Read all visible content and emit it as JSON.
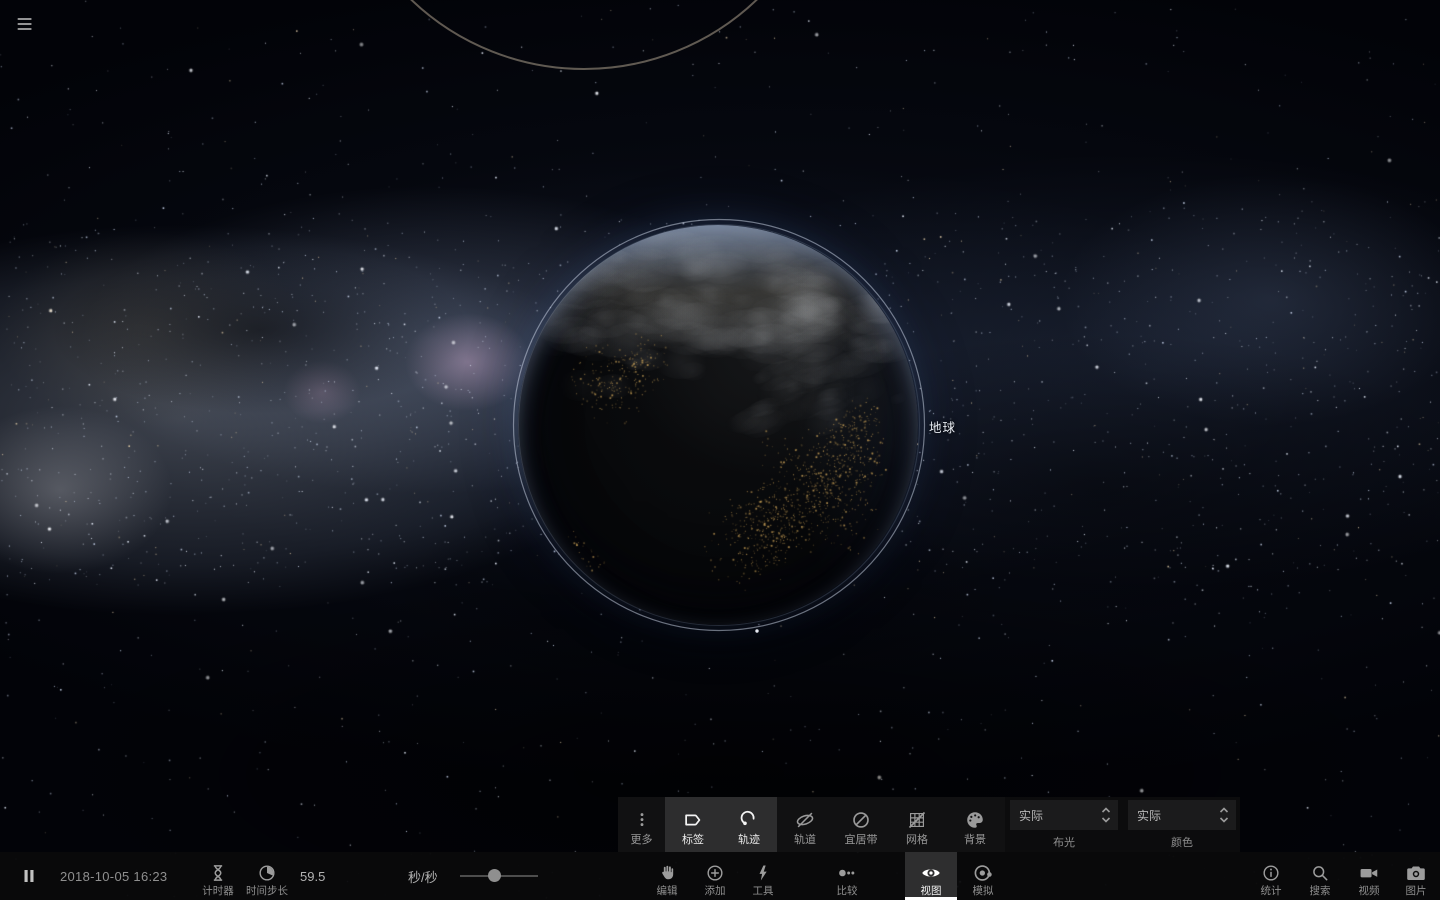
{
  "scene": {
    "body_label": "地球"
  },
  "view_panel": {
    "more_label": "更多",
    "toggles": [
      {
        "id": "labels",
        "label": "标签",
        "active": true
      },
      {
        "id": "trails",
        "label": "轨迹",
        "active": true
      },
      {
        "id": "orbits",
        "label": "轨道",
        "active": false
      },
      {
        "id": "habitable",
        "label": "宜居带",
        "active": false
      },
      {
        "id": "grid",
        "label": "网格",
        "active": false
      },
      {
        "id": "background",
        "label": "背景",
        "active": false
      }
    ],
    "lighting": {
      "value": "实际",
      "label": "布光"
    },
    "color": {
      "value": "实际",
      "label": "颜色"
    }
  },
  "time_bar": {
    "datetime": "2018-10-05 16:23",
    "timer_label": "计时器",
    "timestep_label": "时间步长",
    "timestep_value": "59.5",
    "timestep_unit": "秒/秒",
    "slider_percent": 43
  },
  "toolbar": {
    "edit": "编辑",
    "add": "添加",
    "tools": "工具",
    "compare": "比较",
    "view": "视图",
    "sim": "模拟",
    "stats": "统计",
    "search": "搜索",
    "video": "视频",
    "photo": "图片"
  },
  "colors": {
    "panel_bg": "#111112",
    "active_bg": "#2d2d2e",
    "accent": "#ffffff",
    "label": "#8f8f8f",
    "icon": "#9a9a9a",
    "city_lights": "#c89a4a",
    "atmosphere": "#a9bcd8",
    "selection_ring": "#cdd6e4",
    "orbit_arc": "#9b9184"
  }
}
